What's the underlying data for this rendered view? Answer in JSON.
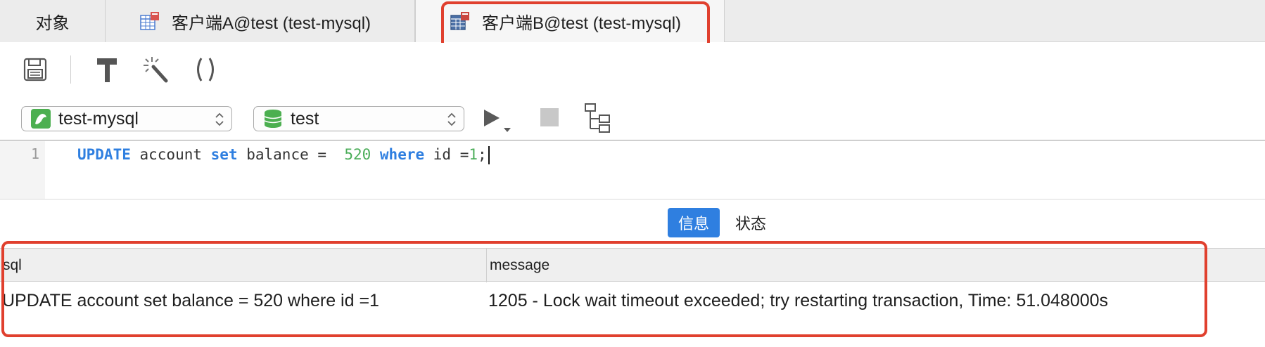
{
  "tabs": [
    {
      "label": "对象",
      "icon": "none"
    },
    {
      "label": "客户端A@test (test-mysql)",
      "icon": "query-table-icon"
    },
    {
      "label": "客户端B@test (test-mysql)",
      "icon": "query-table-icon",
      "active": true
    }
  ],
  "toolbar": {
    "icons": [
      "save-icon",
      "build-hammer-icon",
      "beautify-wand-icon",
      "parentheses-icon"
    ]
  },
  "selectors": {
    "connection": "test-mysql",
    "database": "test"
  },
  "editor": {
    "line_number": "1",
    "code_tokens": {
      "k1": "UPDATE",
      "t1": " account ",
      "k2": "set",
      "t2": " balance =  ",
      "n1": "520",
      "t3": " ",
      "k3": "where",
      "t4": " id =",
      "n2": "1",
      "t5": ";"
    }
  },
  "result_tabs": {
    "info": "信息",
    "status": "状态"
  },
  "grid": {
    "columns": [
      "sql",
      "message"
    ],
    "rows": [
      {
        "sql": "UPDATE account set balance =  520 where id =1",
        "message": "1205 - Lock wait timeout exceeded; try restarting transaction, Time: 51.048000s"
      }
    ]
  },
  "colors": {
    "highlight": "#e0402e",
    "accent": "#2f7fe0",
    "keyword": "#2f7fe0",
    "number": "#4cae5a"
  }
}
